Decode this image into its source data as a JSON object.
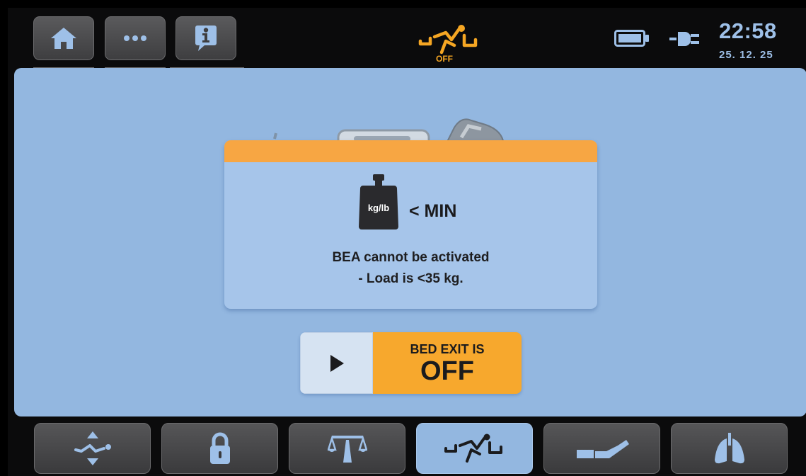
{
  "header": {
    "buttons": [
      {
        "icon": "home-icon"
      },
      {
        "icon": "more-icon"
      },
      {
        "icon": "info-icon"
      }
    ],
    "bed_exit_status": {
      "icon": "bed-exit-icon",
      "label": "OFF",
      "color": "#f5a623"
    },
    "battery_icon": "battery-icon",
    "power_icon": "power-plug-icon",
    "time": "22:58",
    "date": "25. 12. 25"
  },
  "dialog": {
    "accent_color": "#f7a643",
    "weight_label": "kg/lb",
    "min_label": "< MIN",
    "message_line1": "BEA cannot be activated",
    "message_line2": "- Load is <35 kg."
  },
  "bed_exit_toggle": {
    "play_icon": "play-icon",
    "line1": "BED EXIT IS",
    "line2": "OFF",
    "color": "#f7a82d"
  },
  "bottom_nav": {
    "items": [
      {
        "icon": "bed-position-icon",
        "active": false
      },
      {
        "icon": "lock-icon",
        "active": false
      },
      {
        "icon": "scale-icon",
        "active": false
      },
      {
        "icon": "bed-exit-icon",
        "active": true
      },
      {
        "icon": "mattress-icon",
        "active": false
      },
      {
        "icon": "lungs-icon",
        "active": false
      }
    ]
  },
  "colors": {
    "panel": "#93b7e0",
    "clock": "#9ec0e8"
  }
}
